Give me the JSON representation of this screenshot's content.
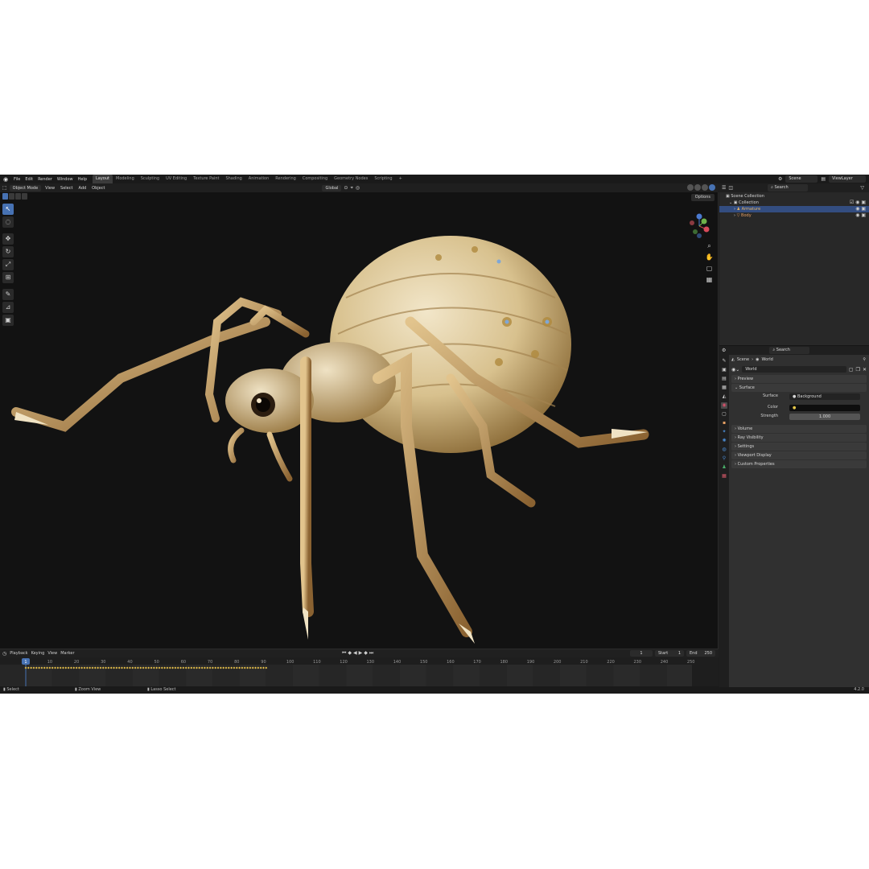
{
  "topbar": {
    "menu": [
      "File",
      "Edit",
      "Render",
      "Window",
      "Help"
    ],
    "workspaces": [
      "Layout",
      "Modeling",
      "Sculpting",
      "UV Editing",
      "Texture Paint",
      "Shading",
      "Animation",
      "Rendering",
      "Compositing",
      "Geometry Nodes",
      "Scripting"
    ],
    "active_workspace": "Layout",
    "add_tab": "+",
    "scene": "Scene",
    "view_layer": "ViewLayer"
  },
  "viewport": {
    "mode": "Object Mode",
    "menus": [
      "View",
      "Select",
      "Add",
      "Object"
    ],
    "transform_orientation": "Global",
    "options_label": "Options"
  },
  "outliner": {
    "search_placeholder": "Search",
    "rows": [
      "Scene Collection",
      "Collection",
      "Armature",
      "Body"
    ]
  },
  "properties": {
    "search_placeholder": "Search",
    "breadcrumb": [
      "Scene",
      "World"
    ],
    "world_name": "World",
    "panels_top": [
      "Preview",
      "Surface"
    ],
    "surface_label": "Surface",
    "surface_value": "Background",
    "color_label": "Color",
    "strength_label": "Strength",
    "strength_value": "1.000",
    "panels_bottom": [
      "Volume",
      "Ray Visibility",
      "Settings",
      "Viewport Display",
      "Custom Properties"
    ],
    "accent": "#4772b3"
  },
  "timeline": {
    "menus": [
      "Playback",
      "Keying",
      "View",
      "Marker"
    ],
    "current_frame": "1",
    "start_label": "Start",
    "start_value": "1",
    "end_label": "End",
    "end_value": "250",
    "ruler": [
      "1",
      "10",
      "20",
      "30",
      "40",
      "50",
      "60",
      "70",
      "80",
      "90",
      "100",
      "110",
      "120",
      "130",
      "140",
      "150",
      "160",
      "170",
      "180",
      "190",
      "200",
      "210",
      "220",
      "230",
      "240",
      "250"
    ],
    "keyframe_color": "#e8c14a"
  },
  "statusbar": {
    "items": [
      "Select",
      "Zoom View",
      "Lasso Select"
    ],
    "version": "4.2.0"
  }
}
